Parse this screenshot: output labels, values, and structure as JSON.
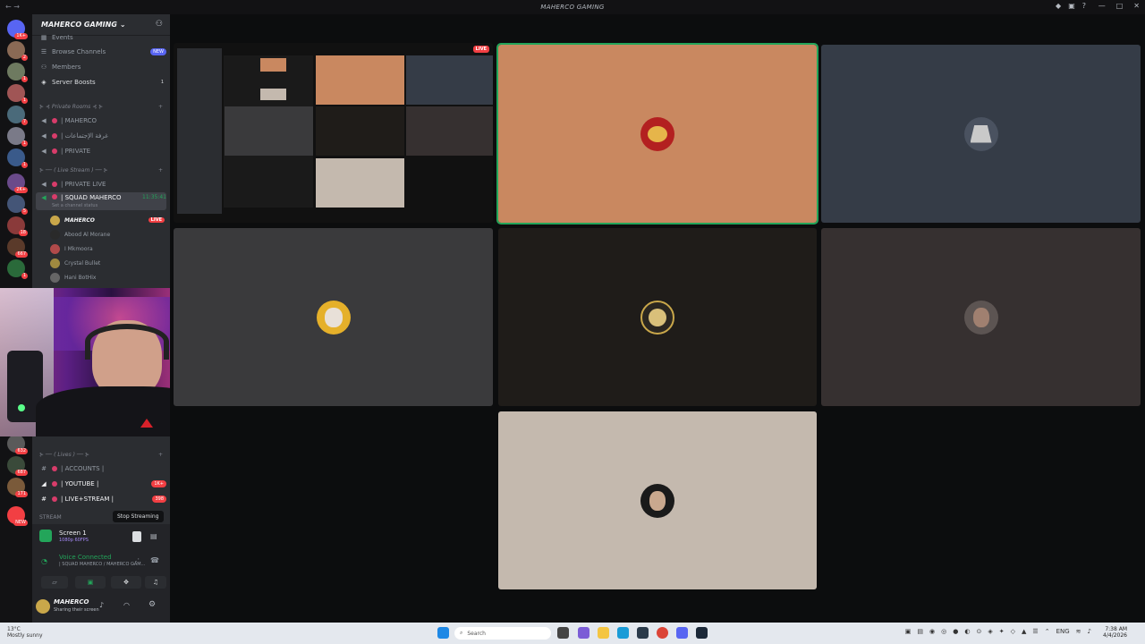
{
  "window": {
    "title": "MAHERCO GAMING"
  },
  "server": {
    "name": "MAHERCO GAMING",
    "menu": [
      {
        "label": "Events"
      },
      {
        "label": "Browse Channels",
        "badge": "NEW"
      },
      {
        "label": "Members"
      },
      {
        "label": "Server Boosts",
        "count": "1"
      }
    ],
    "categories": [
      {
        "label": "⊱ ⊰ Private Rooms ⊰ ⊱"
      },
      {
        "label": "⊱ ── ( Live Stream ) ── ⊱"
      },
      {
        "label": "⊱ ── ( Lives ) ── ⊱"
      },
      {
        "label": "STREAM"
      }
    ],
    "private_rooms": [
      "| MAHERCO",
      "| غرفة الإجتماعات",
      "| PRIVATE"
    ],
    "live_stream": {
      "private_live": "| PRIVATE LIVE",
      "squad": {
        "name": "| SQUAD MAHERCO",
        "timer": "11:35:41",
        "status": "Set a channel status"
      },
      "members": [
        {
          "name": "MAHERCO",
          "live": "LIVE"
        },
        {
          "name": "Abood Al Morane"
        },
        {
          "name": "I Mkmoora"
        },
        {
          "name": "Crystal Bullet"
        },
        {
          "name": "Hani BotHix"
        }
      ]
    },
    "lives": [
      {
        "label": "| ACCOUNTS |"
      },
      {
        "label": "| YOUTUBE |",
        "badge": "1K+"
      },
      {
        "label": "| LIVE+STREAM |",
        "badge": "398"
      }
    ]
  },
  "server_badges": [
    "1K+",
    "2",
    "1",
    "1",
    "7",
    "1",
    "1",
    "2K+",
    "5",
    "18",
    "667",
    "1",
    "632",
    "687",
    "171",
    "NEW"
  ],
  "stream_panel": {
    "tooltip": "Stop Streaming",
    "screen_label": "Screen 1",
    "screen_sub": "1080p 60FPS",
    "voice_status": "Voice Connected",
    "voice_channel": "| SQUAD MAHERCO / MAHERCO GAM..."
  },
  "user": {
    "name": "MAHERCO",
    "status": "Sharing their screen"
  },
  "stage": {
    "live_label": "LIVE"
  },
  "taskbar": {
    "weather_temp": "13°C",
    "weather_desc": "Mostly sunny",
    "search_placeholder": "Search",
    "lang": "ENG",
    "time": "7:38 AM",
    "date": "4/4/2026"
  },
  "colors": {
    "sidebar": "#2b2d31",
    "servers": "#121214",
    "stage": "#0c0d0e",
    "tile_orange": "#c98860",
    "tile_slate": "#353c47",
    "tile_gray": "#3a3a3c",
    "tile_brown": "#1f1c19",
    "tile_taupe": "#363030",
    "tile_beige": "#c4b9ae",
    "live_red": "#f23f43",
    "voice_green": "#23a55a"
  }
}
